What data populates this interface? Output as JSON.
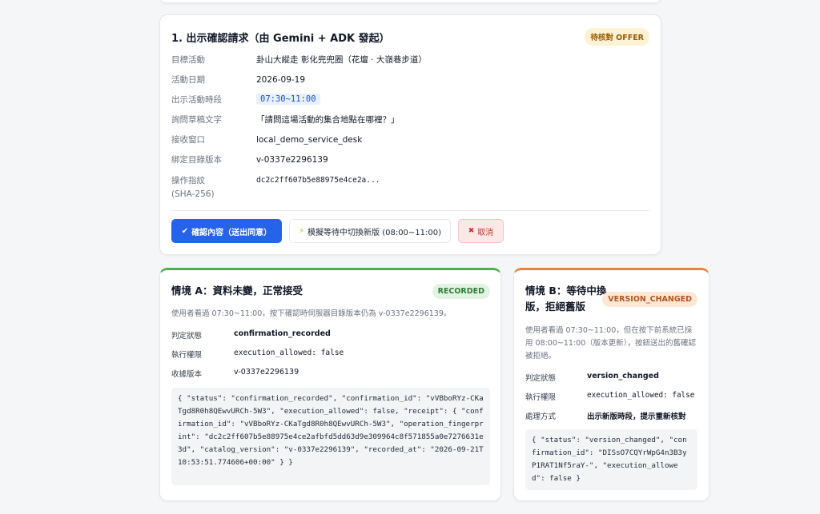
{
  "main": {
    "title": "1. 出示確認請求（由 Gemini + ADK 發起）",
    "badge": "待核對 OFFER",
    "fields": [
      {
        "label": "目標活動",
        "value": "卦山大縱走 彰化兜兜圈（花壇 · 大嶺巷步道）"
      },
      {
        "label": "活動日期",
        "value": "2026-09-19"
      },
      {
        "label": "出示活動時段",
        "value": "07:30~11:00"
      },
      {
        "label": "詢問草稿文字",
        "value": "「請問這場活動的集合地點在哪裡？」"
      },
      {
        "label": "接收窗口",
        "value": "local_demo_service_desk"
      },
      {
        "label": "綁定目錄版本",
        "value": "v-0337e2296139"
      },
      {
        "label": "操作指紋",
        "label2": "(SHA-256)",
        "value": "dc2c2ff607b5e88975e4ce2a..."
      }
    ],
    "buttons": {
      "confirm_icon": "✔",
      "confirm": "確認內容（送出同意）",
      "simulate_icon": "⚡",
      "simulate": "模擬等待中切換新版 (08:00~11:00)",
      "cancel_icon": "✖",
      "cancel": "取消"
    }
  },
  "scenario_a": {
    "title": "情境 A：資料未變，正常接受",
    "badge": "RECORDED",
    "desc": "使用者看過 07:30~11:00，按下確認時伺服器目錄版本仍為 v-0337e2296139。",
    "rows": [
      {
        "label": "判定狀態",
        "value": "confirmation_recorded"
      },
      {
        "label": "執行權限",
        "value": "execution_allowed: false"
      },
      {
        "label": "收據版本",
        "value": "v-0337e2296139"
      }
    ],
    "json": "{ \"status\": \"confirmation_recorded\", \"confirmation_id\": \"vVBboRYz-CKaTgd8R0h8QEwvURCh-5W3\", \"execution_allowed\": false, \"receipt\": { \"confirmation_id\": \"vVBboRYz-CKaTgd8R0h8QEwvURCh-5W3\", \"operation_fingerprint\": \"dc2c2ff607b5e88975e4ce2afbfd5dd63d9e309964c8f571855a0e7276631e3d\", \"catalog_version\": \"v-0337e2296139\", \"recorded_at\": \"2026-09-21T10:53:51.774606+00:00\" } }"
  },
  "scenario_b": {
    "title": "情境 B：等待中換版，拒絕舊版",
    "badge": "VERSION_CHANGED",
    "desc": "使用者看過 07:30~11:00，但在按下前系統已採用 08:00~11:00（版本更新），按鈕送出的舊確認被拒絕。",
    "rows": [
      {
        "label": "判定狀態",
        "value": "version_changed"
      },
      {
        "label": "執行權限",
        "value": "execution_allowed: false"
      },
      {
        "label": "處理方式",
        "value": "出示新版時段，提示重新核對"
      }
    ],
    "json": "{ \"status\": \"version_changed\", \"confirmation_id\": \"DISsO7CQYrWpG4n3B3yP1RAT1Nf5raY-\", \"execution_allowed\": false }"
  },
  "colors": {
    "primary": "#2563eb",
    "success": "#4caf50",
    "warning": "#e8833a",
    "danger": "#c0392b"
  }
}
